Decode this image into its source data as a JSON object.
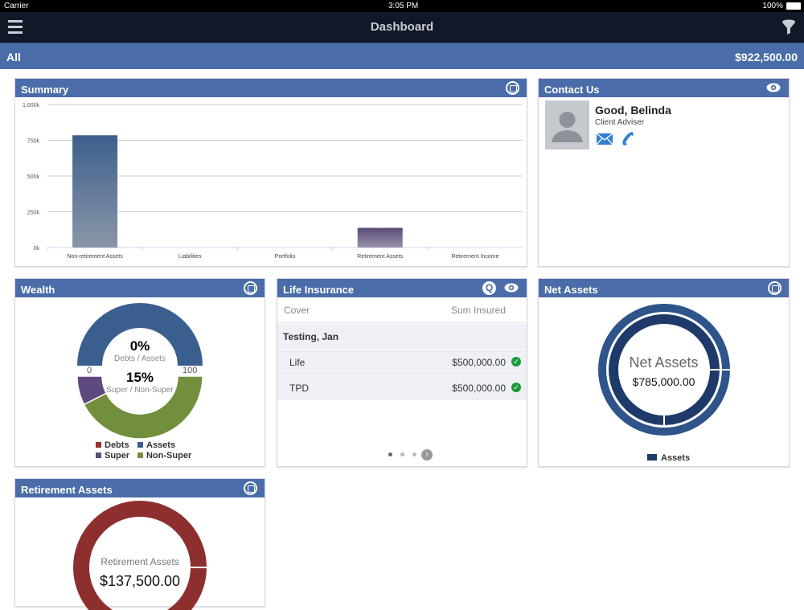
{
  "status": {
    "carrier": "Carrier",
    "time": "3:05 PM",
    "battery": "100%"
  },
  "nav": {
    "title": "Dashboard"
  },
  "filter_bar": {
    "label": "All",
    "total": "$922,500.00"
  },
  "summary": {
    "title": "Summary"
  },
  "chart_data": {
    "type": "bar",
    "title": "Summary",
    "categories": [
      "Non-retirement Assets",
      "Liabilities",
      "Portfolio",
      "Retirement Assets",
      "Retirement Income"
    ],
    "values": [
      785000,
      0,
      0,
      137500,
      0
    ],
    "colors": [
      "#3d5f8c",
      "#3d5f8c",
      "#3d5f8c",
      "#5a4a78",
      "#5a4a78"
    ],
    "yticks": [
      "0k",
      "250k",
      "500k",
      "750k",
      "1,000k"
    ],
    "ylim": [
      0,
      1000000
    ]
  },
  "contact": {
    "title": "Contact Us",
    "name": "Good, Belinda",
    "role": "Client Adviser"
  },
  "wealth": {
    "title": "Wealth",
    "debts_pct": "0%",
    "debts_label": "Debts / Assets",
    "super_pct": "15%",
    "super_label": "Super / Non-Super",
    "scale_min": "0",
    "scale_max": "100",
    "super_fraction": 0.15,
    "legend": [
      {
        "label": "Debts",
        "color": "#9b2f2f"
      },
      {
        "label": "Assets",
        "color": "#3a5f8e"
      },
      {
        "label": "Super",
        "color": "#5e4a7e"
      },
      {
        "label": "Non-Super",
        "color": "#728f3e"
      }
    ]
  },
  "life": {
    "title": "Life Insurance",
    "col_cover": "Cover",
    "col_sum": "Sum Insured",
    "group": "Testing, Jan",
    "rows": [
      {
        "cover": "Life",
        "sum": "$500,000.00"
      },
      {
        "cover": "TPD",
        "sum": "$500,000.00"
      }
    ]
  },
  "net": {
    "title": "Net Assets",
    "label": "Net Assets",
    "value": "$785,000.00",
    "legend": "Assets"
  },
  "retire": {
    "title": "Retirement Assets",
    "label": "Retirement Assets",
    "value": "$137,500.00"
  }
}
